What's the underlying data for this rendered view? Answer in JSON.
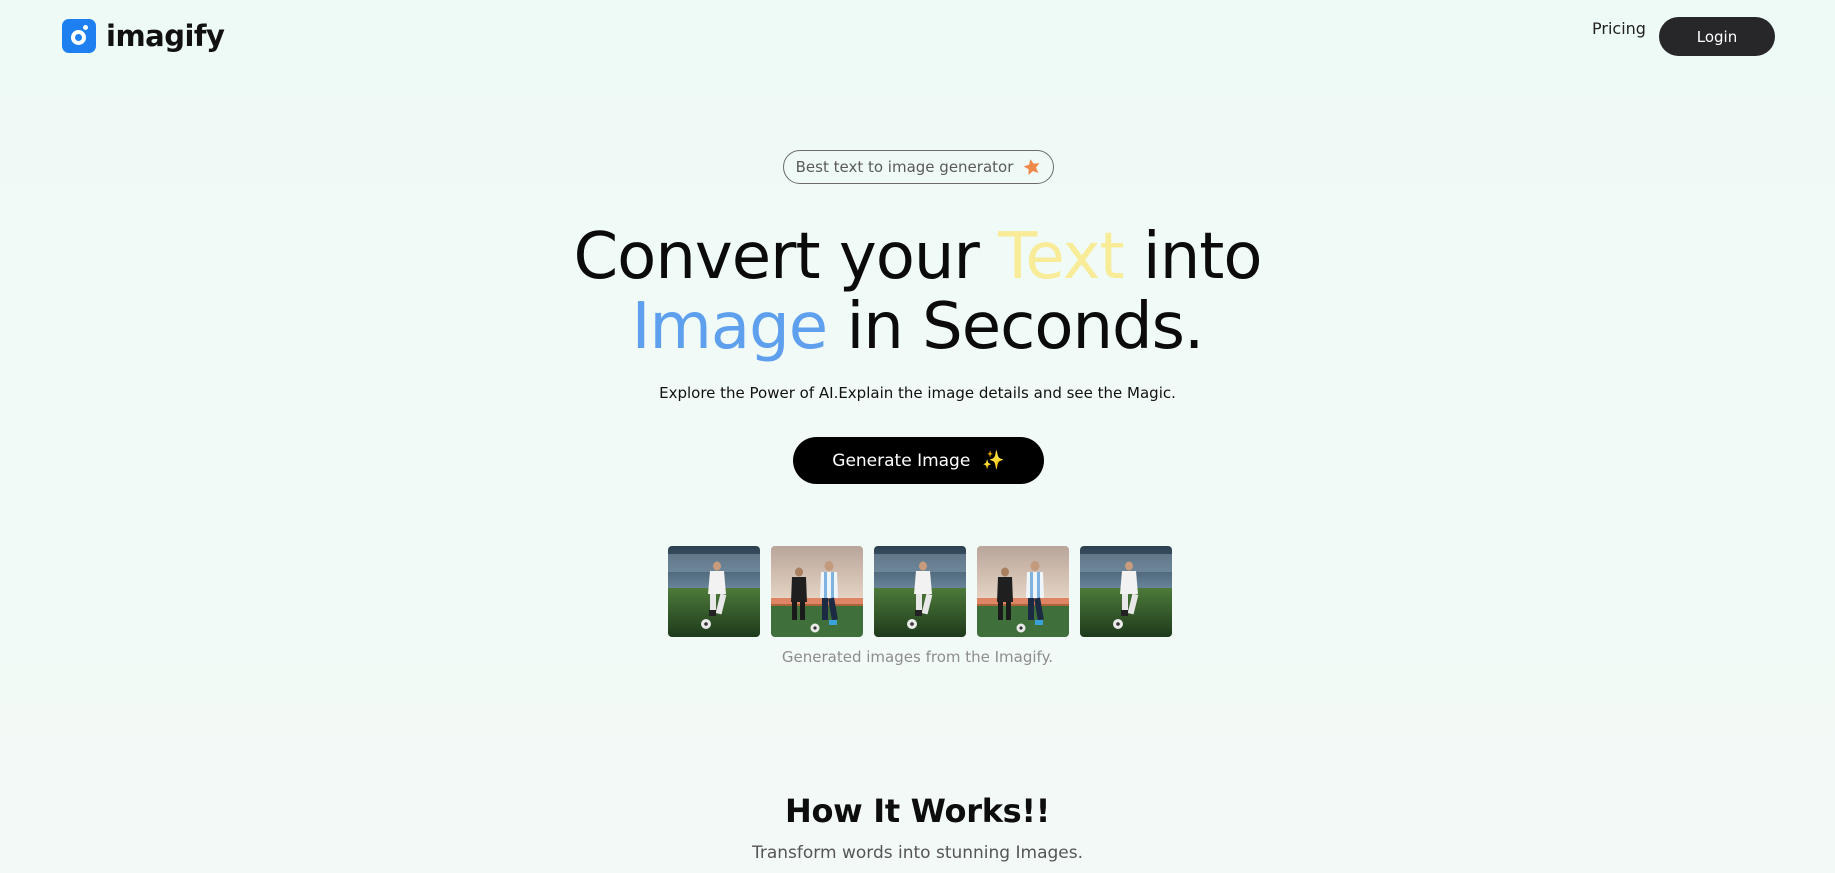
{
  "header": {
    "brand": "imagify",
    "nav_pricing": "Pricing",
    "login_label": "Login"
  },
  "hero": {
    "badge_text": "Best text to image generator",
    "badge_icon": "star-icon",
    "headline": {
      "part1": "Convert your ",
      "highlight1": "Text",
      "part2": " into",
      "highlight2": "Image",
      "part3": " in Seconds."
    },
    "subtitle": "Explore the Power of AI.Explain the image details and see the Magic.",
    "cta_label": "Generate Image",
    "cta_icon": "sparkles-icon"
  },
  "gallery": {
    "caption": "Generated images from the Imagify.",
    "thumbnails": [
      {
        "variant": "stadium-white-kit"
      },
      {
        "variant": "match-two-players"
      },
      {
        "variant": "stadium-white-kit"
      },
      {
        "variant": "match-two-players"
      },
      {
        "variant": "stadium-white-kit"
      }
    ]
  },
  "how_it_works": {
    "title": "How It Works!!",
    "subtitle": "Transform words into stunning Images."
  },
  "colors": {
    "accent_text": "#f9ec98",
    "accent_image": "#5ea0ee",
    "logo_blue": "#1e7ff1",
    "button_dark": "#000000",
    "login_dark": "#27272a"
  }
}
